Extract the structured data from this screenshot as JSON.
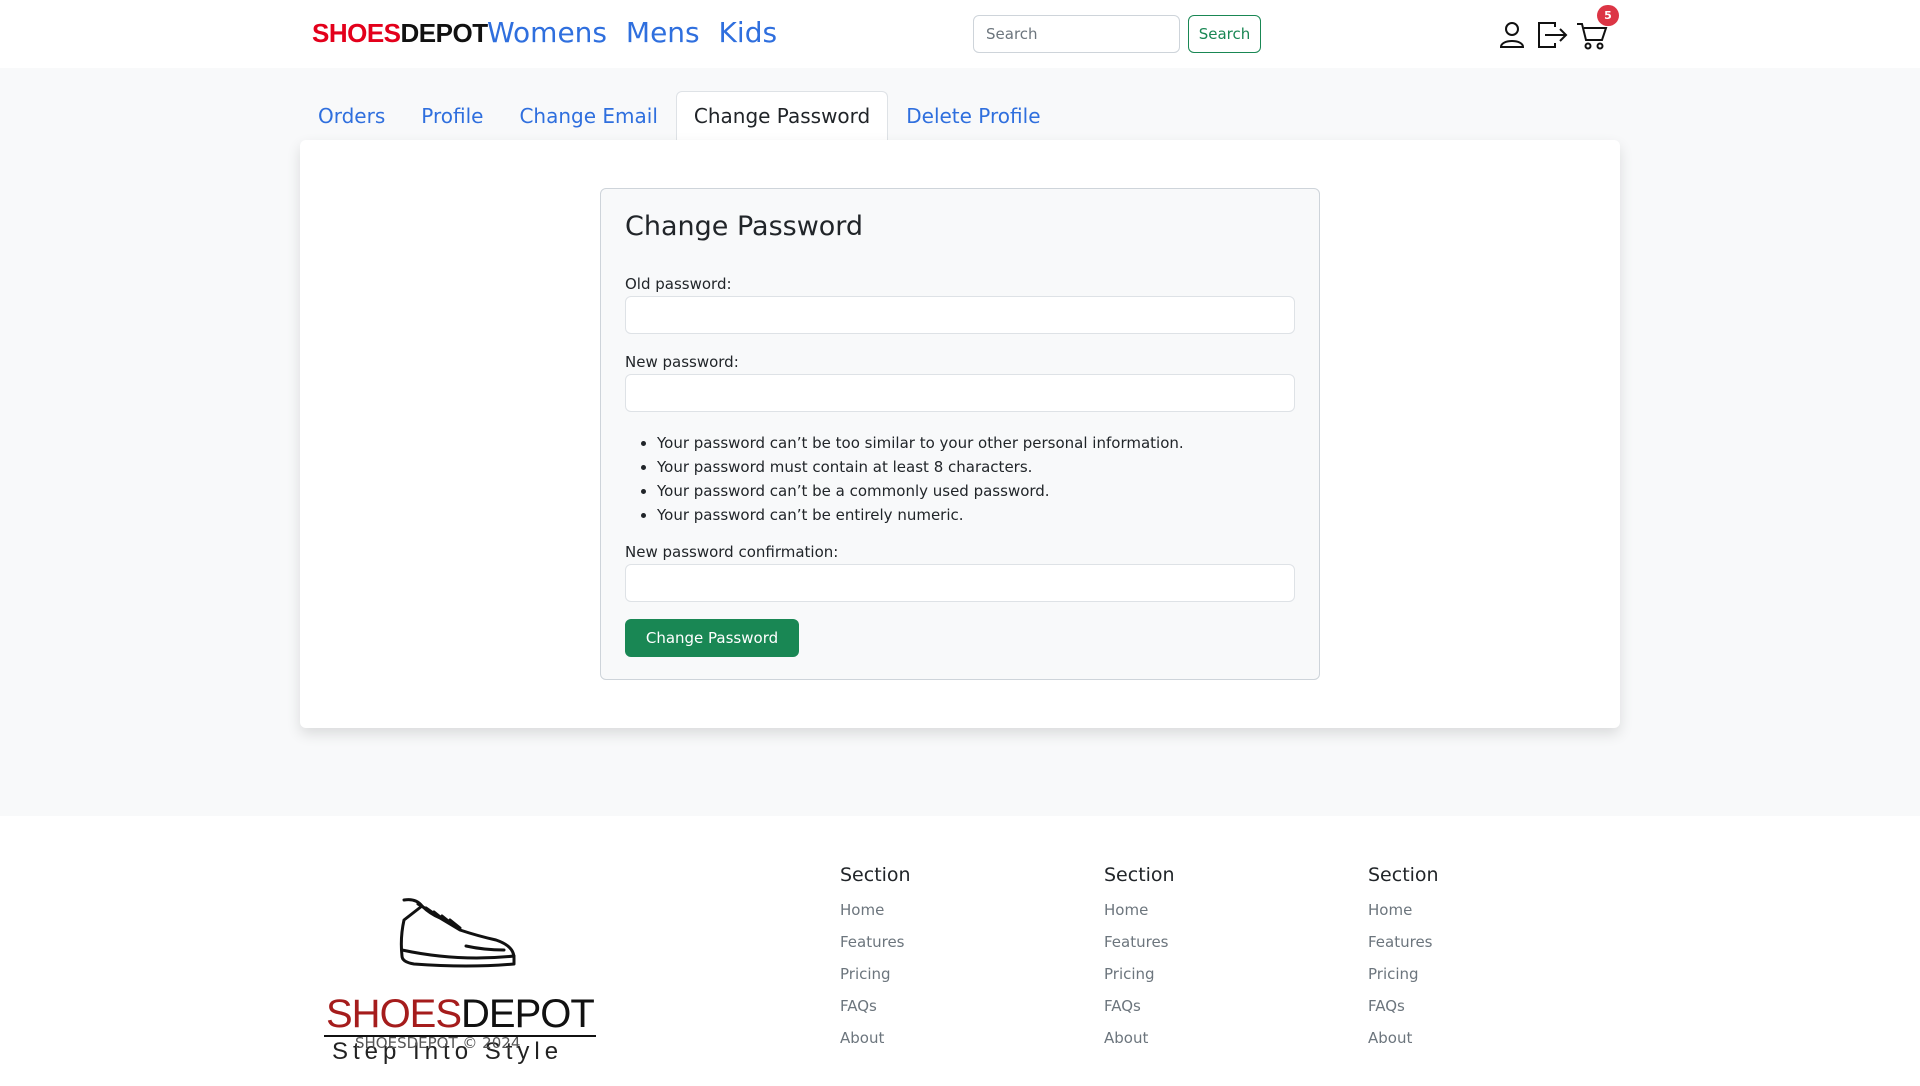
{
  "header": {
    "brand_part1": "SHOES",
    "brand_part2": "DEPOT",
    "nav": [
      "Womens",
      "Mens",
      "Kids"
    ],
    "search_placeholder": "Search",
    "search_button": "Search",
    "cart_count": "5",
    "icons": [
      "user-icon",
      "logout-icon",
      "cart-icon"
    ]
  },
  "tabs": [
    "Orders",
    "Profile",
    "Change Email",
    "Change Password",
    "Delete Profile"
  ],
  "active_tab": "Change Password",
  "form": {
    "title": "Change Password",
    "old_label": "Old password:",
    "new_label": "New password:",
    "rules": [
      "Your password can’t be too similar to your other personal information.",
      "Your password must contain at least 8 characters.",
      "Your password can’t be a commonly used password.",
      "Your password can’t be entirely numeric."
    ],
    "confirm_label": "New password confirmation:",
    "submit": "Change Password"
  },
  "footer": {
    "logo_part1": "SHOES",
    "logo_part2": "DEPOT",
    "tagline": "Step Into Style",
    "copyright": "SHOESDEPOT © 2024",
    "columns": [
      {
        "title": "Section",
        "links": [
          "Home",
          "Features",
          "Pricing",
          "FAQs",
          "About"
        ]
      },
      {
        "title": "Section",
        "links": [
          "Home",
          "Features",
          "Pricing",
          "FAQs",
          "About"
        ]
      },
      {
        "title": "Section",
        "links": [
          "Home",
          "Features",
          "Pricing",
          "FAQs",
          "About"
        ]
      }
    ]
  },
  "colors": {
    "brand_red": "#e3001b",
    "link_blue": "#2f6fde",
    "success_green": "#198754",
    "badge_red": "#dc3545"
  }
}
